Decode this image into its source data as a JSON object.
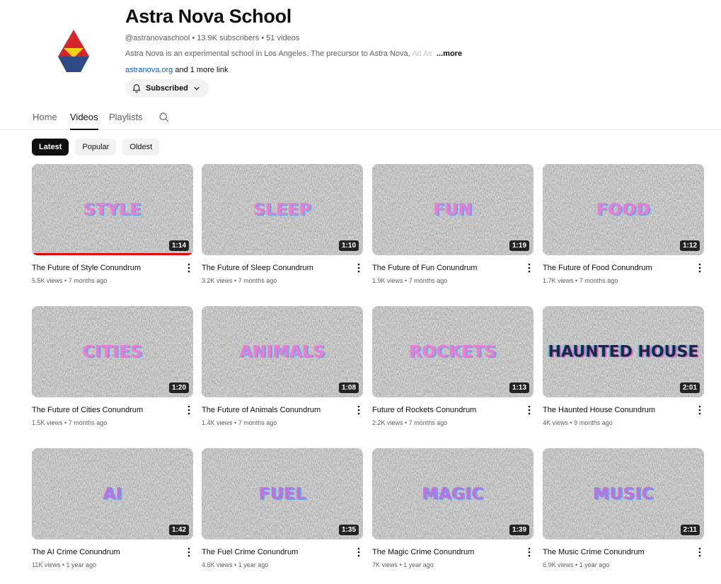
{
  "channel": {
    "name": "Astra Nova School",
    "handle": "@astranovaschool",
    "subscribers": "13.9K subscribers",
    "video_count": "51 videos",
    "separator": "•",
    "description": "Astra Nova is an experimental school in Los Angeles. The precursor to Astra Nova,",
    "description_faded": "Ad As",
    "more_label": "...more",
    "link_text": "astranova.org",
    "more_links_text": "and 1 more link",
    "subscribe_label": "Subscribed",
    "logo_colors": {
      "top": "#d7262a",
      "middle": "#f2d21b",
      "bottom": "#2d4a86"
    }
  },
  "tabs": [
    {
      "label": "Home",
      "active": false
    },
    {
      "label": "Videos",
      "active": true
    },
    {
      "label": "Playlists",
      "active": false
    }
  ],
  "chips": [
    {
      "label": "Latest",
      "active": true
    },
    {
      "label": "Popular",
      "active": false
    },
    {
      "label": "Oldest",
      "active": false
    }
  ],
  "videos": [
    {
      "thumb_text": "STYLE",
      "duration": "1:14",
      "title": "The Future of Style Conundrum",
      "views": "5.5K views",
      "age": "7 months ago",
      "watched": 1.0
    },
    {
      "thumb_text": "SLEEP",
      "duration": "1:10",
      "title": "The Future of Sleep Conundrum",
      "views": "3.2K views",
      "age": "7 months ago"
    },
    {
      "thumb_text": "FUN",
      "duration": "1:19",
      "title": "The Future of Fun Conundrum",
      "views": "1.9K views",
      "age": "7 months ago"
    },
    {
      "thumb_text": "FOOD",
      "duration": "1:12",
      "title": "The Future of Food Conundrum",
      "views": "1.7K views",
      "age": "7 months ago"
    },
    {
      "thumb_text": "CITIES",
      "duration": "1:20",
      "title": "The Future of Cities Conundrum",
      "views": "1.5K views",
      "age": "7 months ago"
    },
    {
      "thumb_text": "ANIMALS",
      "duration": "1:08",
      "title": "The Future of Animals Conundrum",
      "views": "1.4K views",
      "age": "7 months ago"
    },
    {
      "thumb_text": "ROCKETS",
      "duration": "1:13",
      "title": "Future of Rockets Conundrum",
      "views": "2.2K views",
      "age": "7 months ago"
    },
    {
      "thumb_text": "HAUNTED HOUSE",
      "duration": "2:01",
      "title": "The Haunted House Conundrum",
      "views": "4K views",
      "age": "9 months ago",
      "style": "dark"
    },
    {
      "thumb_text": "AI",
      "duration": "1:42",
      "title": "The AI Crime Conundrum",
      "views": "11K views",
      "age": "1 year ago",
      "style": "purple"
    },
    {
      "thumb_text": "FUEL",
      "duration": "1:35",
      "title": "The Fuel Crime Conundrum",
      "views": "4.6K views",
      "age": "1 year ago",
      "style": "purple"
    },
    {
      "thumb_text": "MAGIC",
      "duration": "1:39",
      "title": "The Magic Crime Conundrum",
      "views": "7K views",
      "age": "1 year ago",
      "style": "purple"
    },
    {
      "thumb_text": "MUSIC",
      "duration": "2:11",
      "title": "The Music Crime Conundrum",
      "views": "6.9K views",
      "age": "1 year ago",
      "style": "purple"
    }
  ]
}
